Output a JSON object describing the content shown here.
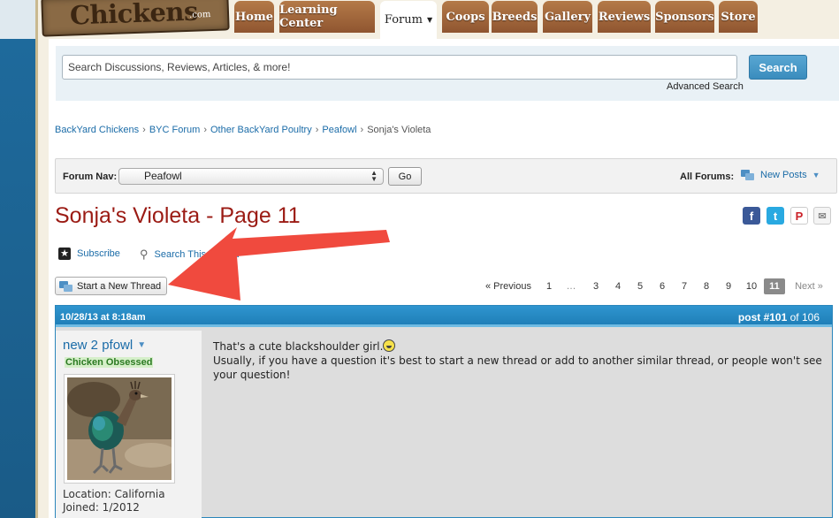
{
  "site": {
    "logo_text": "Chickens",
    "logo_suffix": ".com",
    "nav": [
      {
        "label": "Home"
      },
      {
        "label": "Learning Center"
      },
      {
        "label": "Forum",
        "active": true
      },
      {
        "label": "Coops"
      },
      {
        "label": "Breeds"
      },
      {
        "label": "Gallery"
      },
      {
        "label": "Reviews"
      },
      {
        "label": "Sponsors"
      },
      {
        "label": "Store"
      }
    ]
  },
  "search": {
    "placeholder": "Search Discussions, Reviews, Articles, & more!",
    "button_label": "Search",
    "advanced_label": "Advanced Search"
  },
  "breadcrumb": {
    "items": [
      "BackYard Chickens",
      "BYC Forum",
      "Other BackYard Poultry",
      "Peafowl"
    ],
    "separator": "›",
    "current": "Sonja's Violeta"
  },
  "forum_nav": {
    "label": "Forum Nav:",
    "selected": "Peafowl",
    "go_label": "Go",
    "all_forums_label": "All Forums:",
    "new_posts_label": "New Posts"
  },
  "thread": {
    "title": "Sonja's Violeta - Page 11",
    "subscribe_label": "Subscribe",
    "search_thread_label": "Search This Thread",
    "start_thread_label": "Start a New Thread"
  },
  "share": {
    "facebook": "f",
    "twitter": "t",
    "pinterest": "P",
    "email": "✉"
  },
  "pagination": {
    "previous": "« Previous",
    "pages": [
      "1",
      "…",
      "3",
      "4",
      "5",
      "6",
      "7",
      "8",
      "9",
      "10",
      "11"
    ],
    "current": "11",
    "next": "Next »"
  },
  "post": {
    "date": "10/28/13 at 8:18am",
    "number_label": "post #101",
    "of_label": "of 106",
    "username": "new 2 pfowl",
    "user_title": "Chicken Obsessed",
    "location": "Location: California",
    "joined": "Joined: 1/2012",
    "line1": "That's a cute blackshoulder girl.",
    "line2": "Usually, if you have a question it's best to start a new thread or add to another similar thread, or people won't see your question!"
  },
  "colors": {
    "title_red": "#9b1b14",
    "link_blue": "#1b6ca8",
    "nav_brown": "#8f5530",
    "post_header_blue": "#1f7fb8",
    "annotation_arrow": "#f04a3e"
  }
}
